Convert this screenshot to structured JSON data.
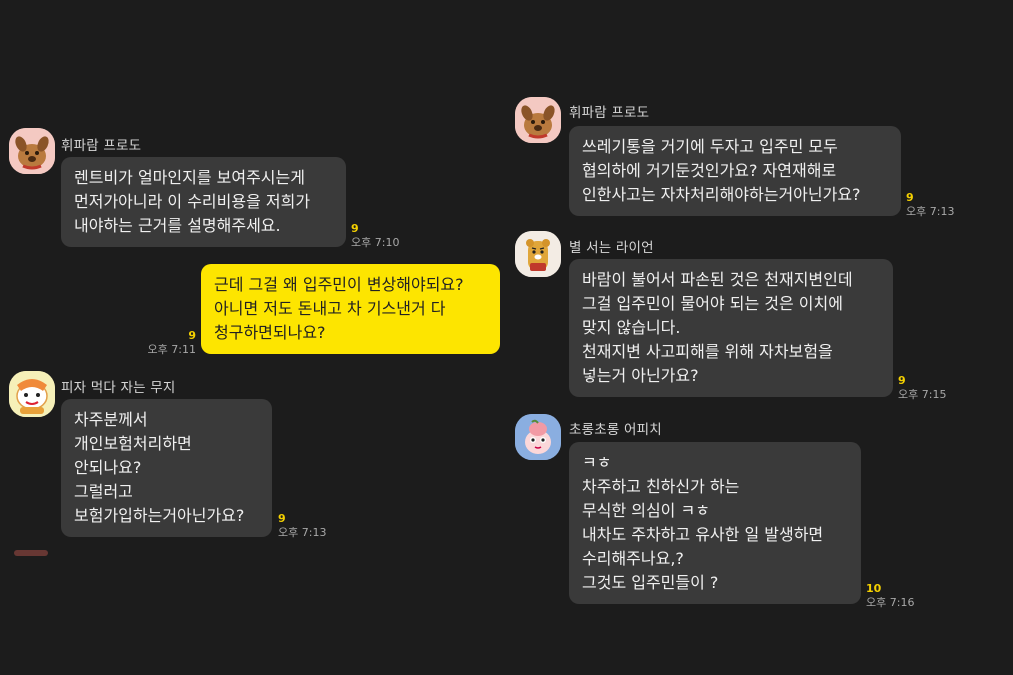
{
  "messages": [
    {
      "sender": "휘파람 프로도",
      "lines": [
        "렌트비가 얼마인지를 보여주시는게",
        "먼저가아니라 이 수리비용을 저희가",
        "내야하는 근거를 설명해주세요."
      ],
      "unread": "9",
      "time": "오후 7:10"
    },
    {
      "sender": "",
      "mine": true,
      "lines": [
        "근데 그걸 왜 입주민이 변상해야되요?",
        "아니면 저도 돈내고 차 기스낸거 다",
        "청구하면되나요?"
      ],
      "unread": "9",
      "time": "오후 7:11"
    },
    {
      "sender": "피자 먹다 자는 무지",
      "lines": [
        "차주분께서",
        "개인보험처리하면",
        "안되나요?",
        "그럴러고",
        "보험가입하는거아닌가요?"
      ],
      "unread": "9",
      "time": "오후 7:13"
    },
    {
      "sender": "휘파람 프로도",
      "lines": [
        "쓰레기통을 거기에 두자고 입주민 모두",
        "협의하에 거기둔것인가요? 자연재해로",
        "인한사고는 자차처리해야하는거아닌가요?"
      ],
      "unread": "9",
      "time": "오후 7:13"
    },
    {
      "sender": "별 서는 라이언",
      "lines": [
        "바람이 불어서 파손된 것은 천재지변인데",
        "그걸 입주민이 물어야 되는 것은 이치에",
        "맞지 않습니다.",
        "천재지변 사고피해를 위해 자차보험을",
        "넣는거 아닌가요?"
      ],
      "unread": "9",
      "time": "오후 7:15"
    },
    {
      "sender": "초롱초롱 어피치",
      "lines": [
        "ㅋㅎ",
        "차주하고 친하신가 하는",
        "무식한 의심이 ㅋㅎ",
        "내차도 주차하고 유사한 일 발생하면",
        "수리해주나요,?",
        "그것도 입주민들이 ?"
      ],
      "unread": "10",
      "time": "오후 7:16"
    }
  ],
  "avatars": {
    "frodo": "frodo-dog-icon",
    "ryan": "ryan-lion-icon",
    "muzi": "muzi-icon",
    "apeach": "apeach-icon"
  },
  "colors": {
    "background": "#1c1c1c",
    "bubble_other": "#3a3a3a",
    "bubble_mine": "#fde500",
    "unread": "#f4d000"
  }
}
